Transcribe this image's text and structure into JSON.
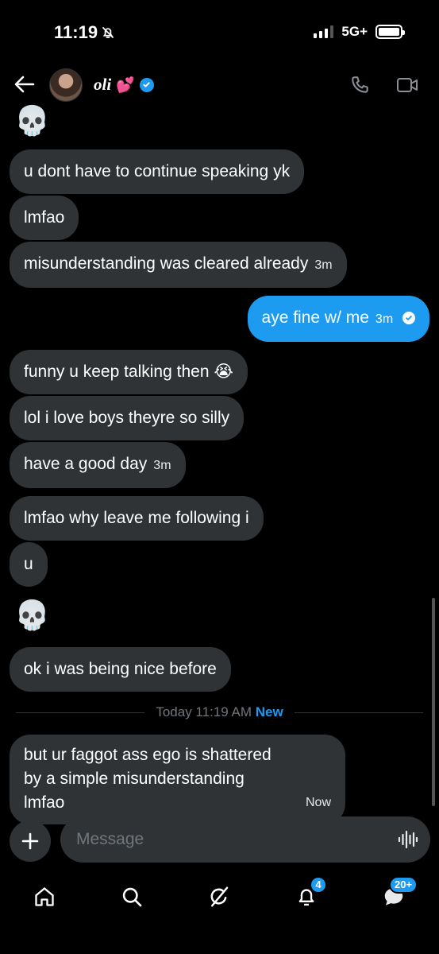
{
  "status_bar": {
    "time": "11:19",
    "network": "5G+"
  },
  "header": {
    "contact_name": "oli",
    "name_emoji": "💕"
  },
  "messages": [
    {
      "side": "received",
      "text": "💀",
      "emoji": true
    },
    {
      "side": "received",
      "text": "u dont have to continue speaking yk"
    },
    {
      "side": "received",
      "text": "lmfao"
    },
    {
      "side": "received",
      "text": "misunderstanding was cleared already",
      "time": "3m"
    },
    {
      "side": "sent",
      "text": "aye fine w/ me",
      "time": "3m"
    },
    {
      "side": "received",
      "text": "funny u keep talking then 😭"
    },
    {
      "side": "received",
      "text": "lol i love boys theyre so silly"
    },
    {
      "side": "received",
      "text": "have a good day",
      "time": "3m"
    },
    {
      "side": "received",
      "text": "lmfao why leave me following i"
    },
    {
      "side": "received",
      "text": "u"
    },
    {
      "side": "received",
      "text": "💀",
      "emoji": true
    },
    {
      "side": "received",
      "text": "ok i was being nice before"
    },
    {
      "side": "received",
      "text": "but ur faggot ass ego is shattered by a simple misunderstanding lmfao",
      "time": "Now"
    }
  ],
  "divider": {
    "label": "Today 11:19 AM",
    "new_label": "New"
  },
  "composer": {
    "placeholder": "Message"
  },
  "tab_bar": {
    "items": [
      "home",
      "search",
      "grok",
      "notifications",
      "messages"
    ],
    "notifications_badge": "4",
    "messages_badge": "20+"
  },
  "colors": {
    "accent": "#1d9bf0",
    "bubble_received": "#2f3336",
    "background": "#000000"
  }
}
